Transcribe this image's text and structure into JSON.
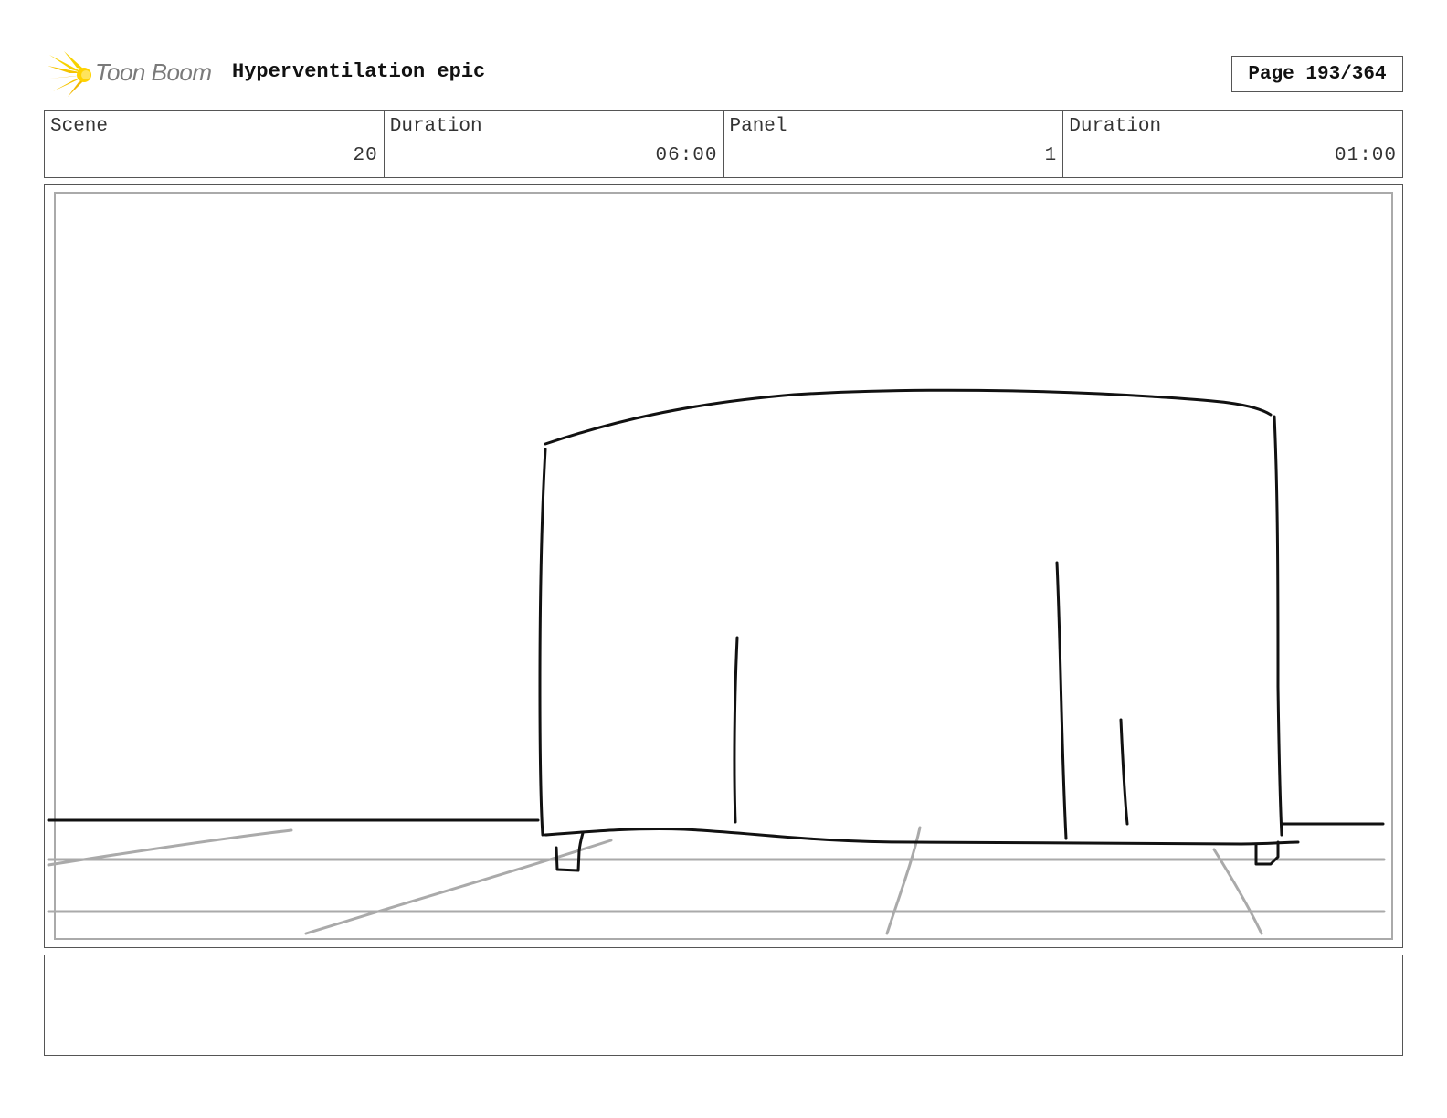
{
  "header": {
    "logo_text": "Toon Boom",
    "project_title": "Hyperventilation epic",
    "page_label": "Page 193/364"
  },
  "info": {
    "scene_label": "Scene",
    "scene_value": "20",
    "scene_duration_label": "Duration",
    "scene_duration_value": "06:00",
    "panel_label": "Panel",
    "panel_value": "1",
    "panel_duration_label": "Duration",
    "panel_duration_value": "01:00"
  },
  "colors": {
    "logo_star": "#f5c400",
    "logo_text": "#7a7a7a",
    "ink": "#111111",
    "guide_lines": "#aaaaaa"
  },
  "icons": {
    "logo": "starburst-icon"
  }
}
